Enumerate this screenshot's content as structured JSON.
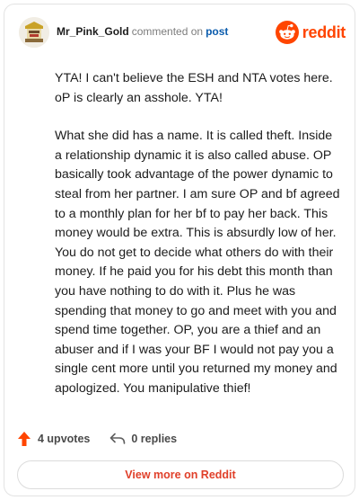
{
  "header": {
    "username": "Mr_Pink_Gold",
    "action_text": "commented on",
    "post_link": "post",
    "brand_name": "reddit"
  },
  "comment": {
    "paragraphs": [
      "YTA! I can't believe the ESH and NTA votes here. oP is clearly an asshole. YTA!",
      "What she did has a name. It is called theft. Inside a relationship dynamic it is also called abuse. OP basically took advantage of the power dynamic to steal from her partner. I am sure OP and bf agreed to a monthly plan for her bf to pay her back. This money would be extra. This is absurdly low of her. You do not get to decide what others do with their money. If he paid you for his debt this month than you have nothing to do with it. Plus he was spending that money to go and meet with you and spend time together. OP, you are a thief and an abuser and if I was your BF I would not pay you a single cent more until you returned my money and apologized. You manipulative thief!"
    ]
  },
  "actions": {
    "upvotes_label": "4 upvotes",
    "replies_label": "0 replies"
  },
  "footer": {
    "view_more_label": "View more on Reddit"
  },
  "colors": {
    "brand": "#ff4500",
    "link": "#0b5cad",
    "view_more_text": "#e0402a"
  },
  "icons": {
    "avatar": "avatar-icon",
    "brand": "reddit-logo-icon",
    "upvote": "upvote-arrow-icon",
    "reply": "reply-arrow-icon"
  }
}
